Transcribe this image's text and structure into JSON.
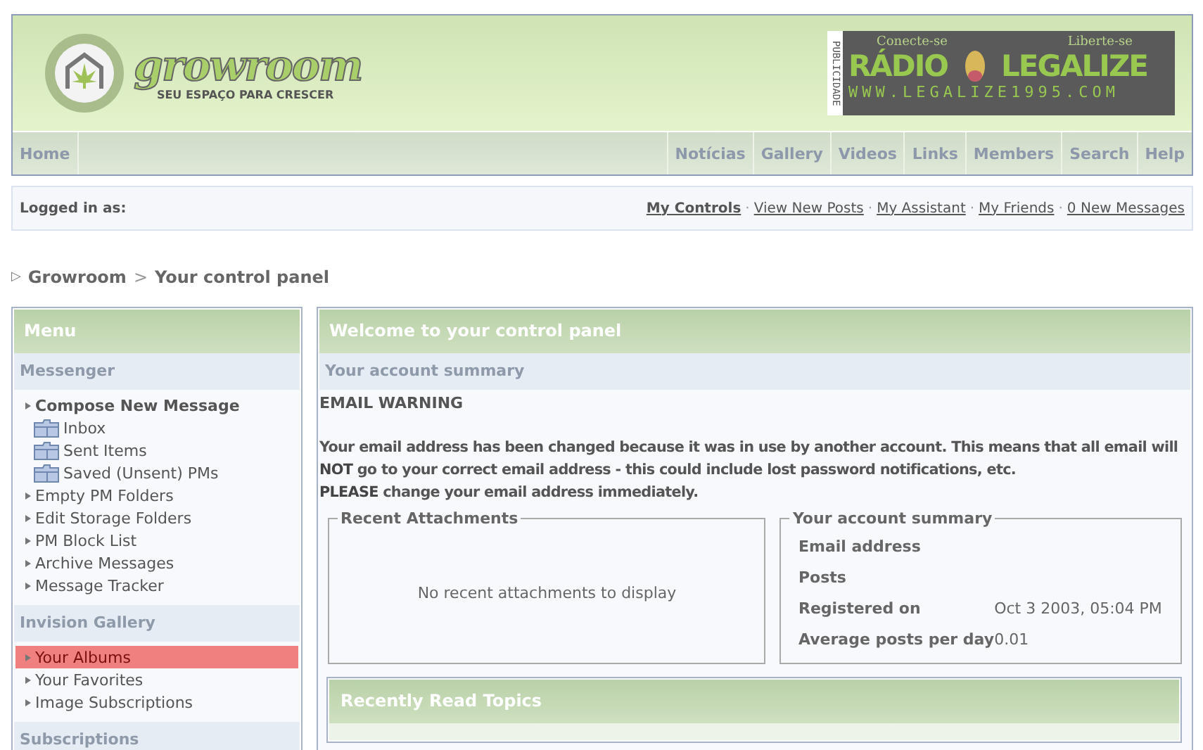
{
  "logo": {
    "name": "growroom",
    "tagline": "SEU ESPAÇO PARA CRESCER"
  },
  "ad": {
    "side_label": "PUBLICIDADE",
    "top_left": "Conecte-se",
    "top_right": "Liberte-se",
    "word_left": "RÁDIO",
    "word_right": "LEGALIZE",
    "url": "WWW.LEGALIZE1995.COM"
  },
  "nav": {
    "left": [
      "Home"
    ],
    "right": [
      "Notícias",
      "Gallery",
      "Videos",
      "Links",
      "Members",
      "Search",
      "Help"
    ]
  },
  "user_bar": {
    "label": "Logged in as:",
    "links": [
      {
        "label": "My Controls",
        "bold": true
      },
      {
        "label": "View New Posts",
        "bold": false
      },
      {
        "label": "My Assistant",
        "bold": false
      },
      {
        "label": "My Friends",
        "bold": false
      },
      {
        "label": "0 New Messages",
        "bold": false
      }
    ],
    "separator": "·"
  },
  "breadcrumb": {
    "marker": "▷",
    "items": [
      "Growroom",
      "Your control panel"
    ],
    "separator": ">"
  },
  "sidebar": {
    "title": "Menu",
    "sections": [
      {
        "title": "Messenger",
        "items": [
          {
            "kind": "link",
            "label": "Compose New Message",
            "bold": true,
            "selected": false
          },
          {
            "kind": "folder",
            "label": "Inbox",
            "bold": false,
            "selected": false
          },
          {
            "kind": "folder",
            "label": "Sent Items",
            "bold": false,
            "selected": false
          },
          {
            "kind": "folder",
            "label": "Saved (Unsent) PMs",
            "bold": false,
            "selected": false
          },
          {
            "kind": "link",
            "label": "Empty PM Folders",
            "bold": false,
            "selected": false
          },
          {
            "kind": "link",
            "label": "Edit Storage Folders",
            "bold": false,
            "selected": false
          },
          {
            "kind": "link",
            "label": "PM Block List",
            "bold": false,
            "selected": false
          },
          {
            "kind": "link",
            "label": "Archive Messages",
            "bold": false,
            "selected": false
          },
          {
            "kind": "link",
            "label": "Message Tracker",
            "bold": false,
            "selected": false
          }
        ]
      },
      {
        "title": "Invision Gallery",
        "items": [
          {
            "kind": "link",
            "label": "Your Albums",
            "bold": false,
            "selected": true
          },
          {
            "kind": "link",
            "label": "Your Favorites",
            "bold": false,
            "selected": false
          },
          {
            "kind": "link",
            "label": "Image Subscriptions",
            "bold": false,
            "selected": false
          }
        ]
      },
      {
        "title": "Subscriptions"
      }
    ]
  },
  "main": {
    "title": "Welcome to your control panel",
    "subtitle": "Your account summary",
    "warning_title": "EMAIL WARNING",
    "warning_lines": [
      "Your email address has been changed because it was in use by another account. This means that all email will **NOT** go to your correct email address - this could include lost password notifications, etc.",
      "**PLEASE** change your email address immediately."
    ],
    "attachments": {
      "title": "Recent Attachments",
      "empty_text": "No recent attachments to display"
    },
    "summary": {
      "title": "Your account summary",
      "rows": [
        {
          "label": "Email address"
        },
        {
          "label": "Posts"
        },
        {
          "label": "Registered on",
          "value": "Oct 3 2003, 05:04 PM"
        },
        {
          "label": "Average posts per day",
          "value": "0.01"
        }
      ]
    },
    "recent": {
      "title": "Recently Read Topics"
    }
  }
}
